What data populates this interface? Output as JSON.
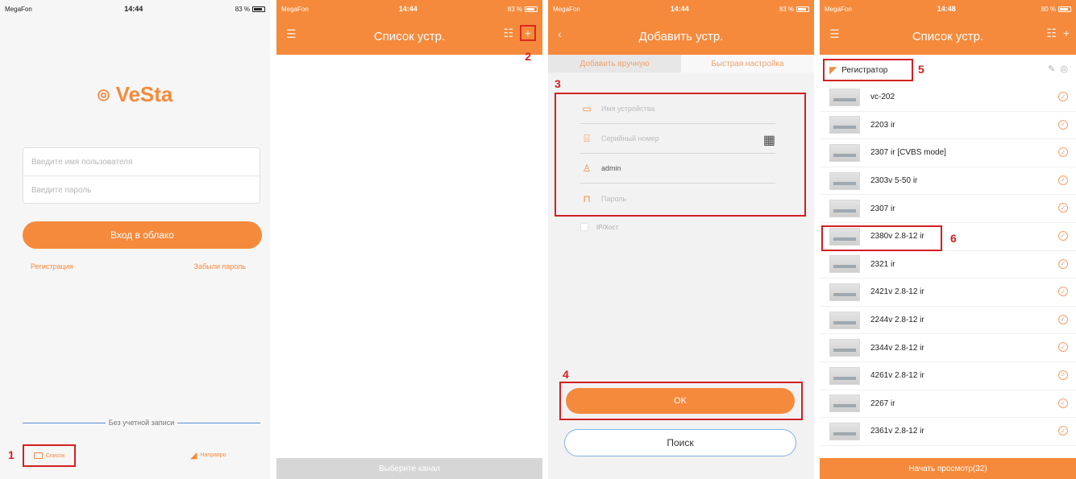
{
  "colors": {
    "accent": "#f58a3c",
    "highlight": "#d32020",
    "link_blue": "#7fb1e6"
  },
  "panel1": {
    "status": {
      "carrier": "MegaFon",
      "time": "14:44",
      "battery": "83 %"
    },
    "logo": "VeSta",
    "username_placeholder": "Введите имя пользователя",
    "password_placeholder": "Введите пароль",
    "cloud_button": "Вход в облако",
    "register_link": "Регистрация",
    "forgot_link": "Забыли пароль",
    "no_account": "Без учетной записи",
    "tab_list": "Список",
    "tab_guide": "Направро",
    "marker": "1"
  },
  "panel2": {
    "status": {
      "carrier": "MegaFon",
      "time": "14:44",
      "battery": "83 %"
    },
    "title": "Список устр.",
    "select_channel": "Выберите канал",
    "marker": "2"
  },
  "panel3": {
    "status": {
      "carrier": "MegaFon",
      "time": "14:44",
      "battery": "83 %"
    },
    "title": "Добавить устр.",
    "tab_manual": "Добавить вручную",
    "tab_quick": "Быстрая настройка",
    "device_name_placeholder": "Имя устройства",
    "serial_placeholder": "Серийный номер",
    "username_value": "admin",
    "password_placeholder": "Пароль",
    "iphost_label": "IP/Хост",
    "ok_button": "OK",
    "search_button": "Поиск",
    "marker_form": "3",
    "marker_ok": "4"
  },
  "panel4": {
    "status": {
      "carrier": "MegaFon",
      "time": "14:48",
      "battery": "80 %"
    },
    "title": "Список устр.",
    "recorder_label": "Регистратор",
    "marker_recorder": "5",
    "marker_camera": "6",
    "cameras": [
      "vc-202",
      "2203 ir",
      "2307 ir [CVBS mode]",
      "2303v 5-50 ir",
      "2307 ir",
      "2380v 2.8-12 ir",
      "2321 ir",
      "2421v 2.8-12 ir",
      "2244v 2.8-12 ir",
      "2344v 2.8-12 ir",
      "4261v 2.8-12 ir",
      "2267 ir",
      "2361v 2.8-12 ir"
    ],
    "start_button": "Начать просмотр(32)"
  }
}
